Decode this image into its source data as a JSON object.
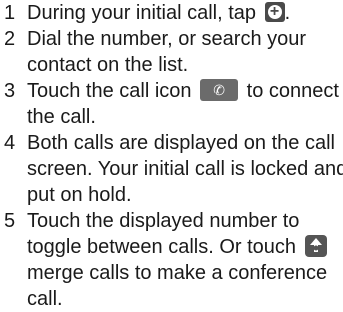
{
  "steps": [
    {
      "number": "1",
      "lines": [
        "During your initial call, tap ",
        "."
      ]
    },
    {
      "number": "2",
      "lines": [
        "Dial the number, or search your",
        "contact on the list."
      ]
    },
    {
      "number": "3",
      "lines": [
        "Touch the call icon ",
        " to connect",
        "the call."
      ]
    },
    {
      "number": "4",
      "lines": [
        "Both calls are displayed on the call",
        "screen. Your initial call is locked and",
        "put on hold."
      ]
    },
    {
      "number": "5",
      "lines": [
        "Touch the displayed number to",
        "toggle between calls. Or touch ",
        "merge calls to make a conference",
        "call."
      ]
    }
  ],
  "icons": {
    "add_call": "plus-circle-icon",
    "call": "phone-icon",
    "merge": "merge-calls-icon"
  }
}
